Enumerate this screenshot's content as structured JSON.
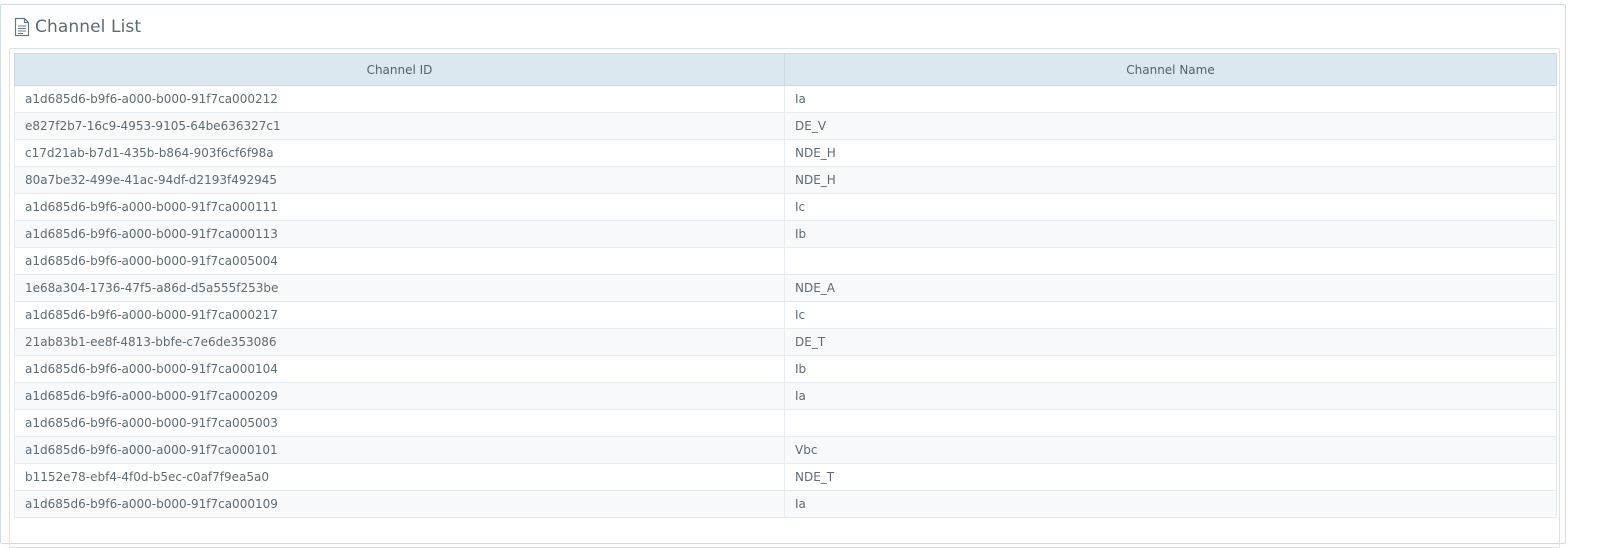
{
  "panel": {
    "title": "Channel List",
    "icon": "document-icon"
  },
  "table": {
    "headers": {
      "channel_id": "Channel ID",
      "channel_name": "Channel Name"
    },
    "rows": [
      {
        "id": "a1d685d6-b9f6-a000-b000-91f7ca000212",
        "name": "Ia"
      },
      {
        "id": "e827f2b7-16c9-4953-9105-64be636327c1",
        "name": "DE_V"
      },
      {
        "id": "c17d21ab-b7d1-435b-b864-903f6cf6f98a",
        "name": "NDE_H"
      },
      {
        "id": "80a7be32-499e-41ac-94df-d2193f492945",
        "name": "NDE_H"
      },
      {
        "id": "a1d685d6-b9f6-a000-b000-91f7ca000111",
        "name": "Ic"
      },
      {
        "id": "a1d685d6-b9f6-a000-b000-91f7ca000113",
        "name": "Ib"
      },
      {
        "id": "a1d685d6-b9f6-a000-b000-91f7ca005004",
        "name": ""
      },
      {
        "id": "1e68a304-1736-47f5-a86d-d5a555f253be",
        "name": "NDE_A"
      },
      {
        "id": "a1d685d6-b9f6-a000-b000-91f7ca000217",
        "name": "Ic"
      },
      {
        "id": "21ab83b1-ee8f-4813-bbfe-c7e6de353086",
        "name": "DE_T"
      },
      {
        "id": "a1d685d6-b9f6-a000-b000-91f7ca000104",
        "name": "Ib"
      },
      {
        "id": "a1d685d6-b9f6-a000-b000-91f7ca000209",
        "name": "Ia"
      },
      {
        "id": "a1d685d6-b9f6-a000-b000-91f7ca005003",
        "name": ""
      },
      {
        "id": "a1d685d6-b9f6-a000-a000-91f7ca000101",
        "name": "Vbc"
      },
      {
        "id": "b1152e78-ebf4-4f0d-b5ec-c0af7f9ea5a0",
        "name": "NDE_T"
      },
      {
        "id": "a1d685d6-b9f6-a000-b000-91f7ca000109",
        "name": "Ia"
      }
    ]
  }
}
